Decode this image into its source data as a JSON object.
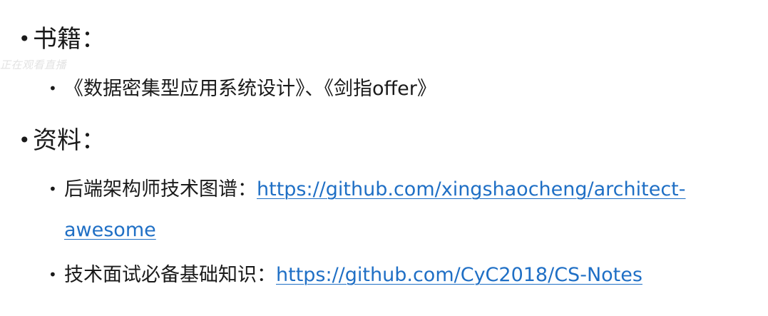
{
  "watermark": "正在观看直播",
  "sections": [
    {
      "heading": "书籍：",
      "items": [
        {
          "text": "《数据密集型应用系统设计》、《剑指offer》"
        }
      ]
    },
    {
      "heading": "资料：",
      "items": [
        {
          "label": "后端架构师技术图谱：",
          "link": "https://github.com/xingshaocheng/architect-awesome"
        },
        {
          "label": "技术面试必备基础知识：",
          "link": "https://github.com/CyC2018/CS-Notes"
        }
      ]
    }
  ],
  "colors": {
    "link": "#1f6fc5",
    "text": "#1a1a1a"
  }
}
